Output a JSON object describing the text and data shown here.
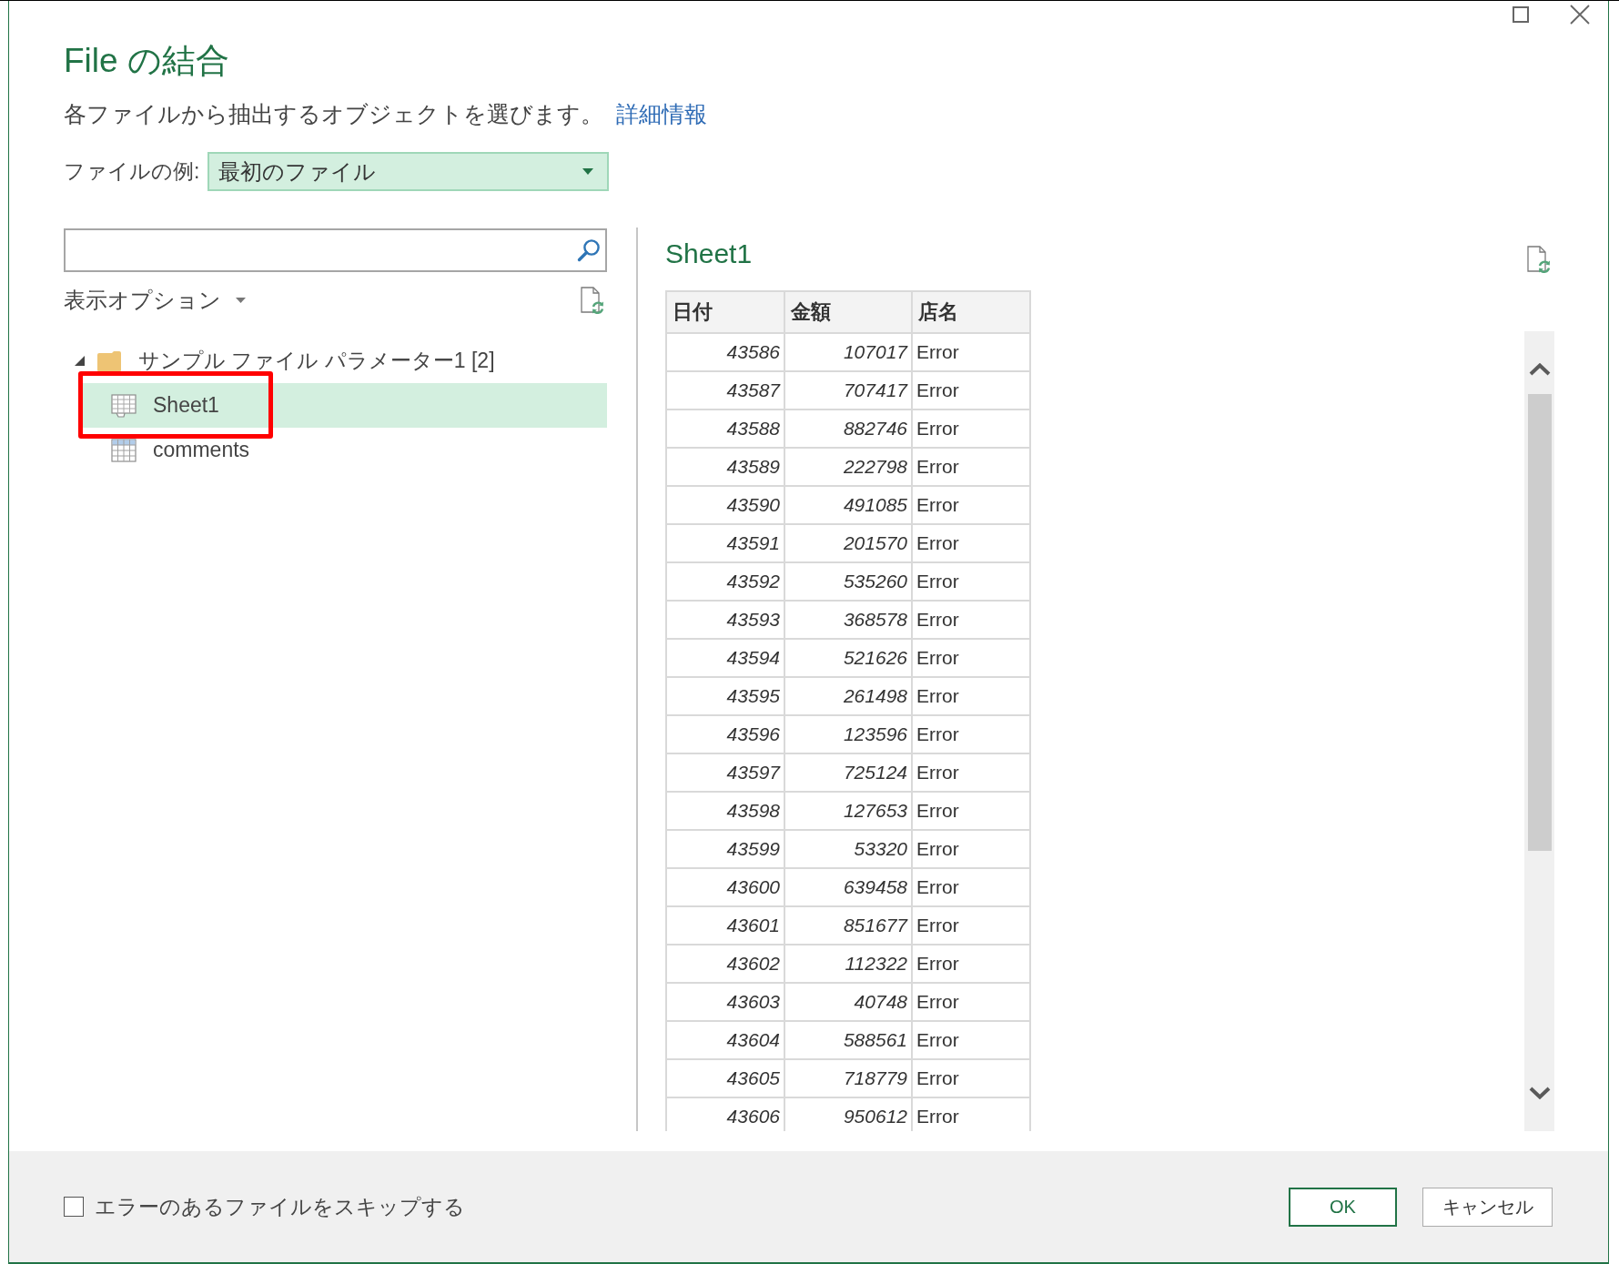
{
  "dialog": {
    "title": "File の結合",
    "subtitle": "各ファイルから抽出するオブジェクトを選びます。",
    "help_link": "詳細情報"
  },
  "sample_file": {
    "label": "ファイルの例:",
    "value": "最初のファイル"
  },
  "navigator": {
    "display_options": "表示オプション",
    "tree": [
      {
        "kind": "folder",
        "label": "サンプル ファイル パラメーター1 [2]",
        "expanded": true,
        "selected": false,
        "children": [
          {
            "kind": "sheet",
            "label": "Sheet1",
            "selected": true,
            "annotated": true
          },
          {
            "kind": "table",
            "label": "comments",
            "selected": false,
            "annotated": false
          }
        ]
      }
    ]
  },
  "preview": {
    "title": "Sheet1",
    "table": {
      "columns": [
        {
          "label": "日付",
          "kind": "number"
        },
        {
          "label": "金額",
          "kind": "number"
        },
        {
          "label": "店名",
          "kind": "text"
        }
      ],
      "rows": [
        [
          "43586",
          "107017",
          "Error"
        ],
        [
          "43587",
          "707417",
          "Error"
        ],
        [
          "43588",
          "882746",
          "Error"
        ],
        [
          "43589",
          "222798",
          "Error"
        ],
        [
          "43590",
          "491085",
          "Error"
        ],
        [
          "43591",
          "201570",
          "Error"
        ],
        [
          "43592",
          "535260",
          "Error"
        ],
        [
          "43593",
          "368578",
          "Error"
        ],
        [
          "43594",
          "521626",
          "Error"
        ],
        [
          "43595",
          "261498",
          "Error"
        ],
        [
          "43596",
          "123596",
          "Error"
        ],
        [
          "43597",
          "725124",
          "Error"
        ],
        [
          "43598",
          "127653",
          "Error"
        ],
        [
          "43599",
          "53320",
          "Error"
        ],
        [
          "43600",
          "639458",
          "Error"
        ],
        [
          "43601",
          "851677",
          "Error"
        ],
        [
          "43602",
          "112322",
          "Error"
        ],
        [
          "43603",
          "40748",
          "Error"
        ],
        [
          "43604",
          "588561",
          "Error"
        ],
        [
          "43605",
          "718779",
          "Error"
        ],
        [
          "43606",
          "950612",
          "Error"
        ]
      ]
    }
  },
  "footer": {
    "skip_errors": {
      "label": "エラーのあるファイルをスキップする",
      "checked": false
    },
    "buttons": [
      {
        "label": "OK",
        "kind": "primary"
      },
      {
        "label": "キャンセル",
        "kind": "secondary"
      }
    ]
  }
}
